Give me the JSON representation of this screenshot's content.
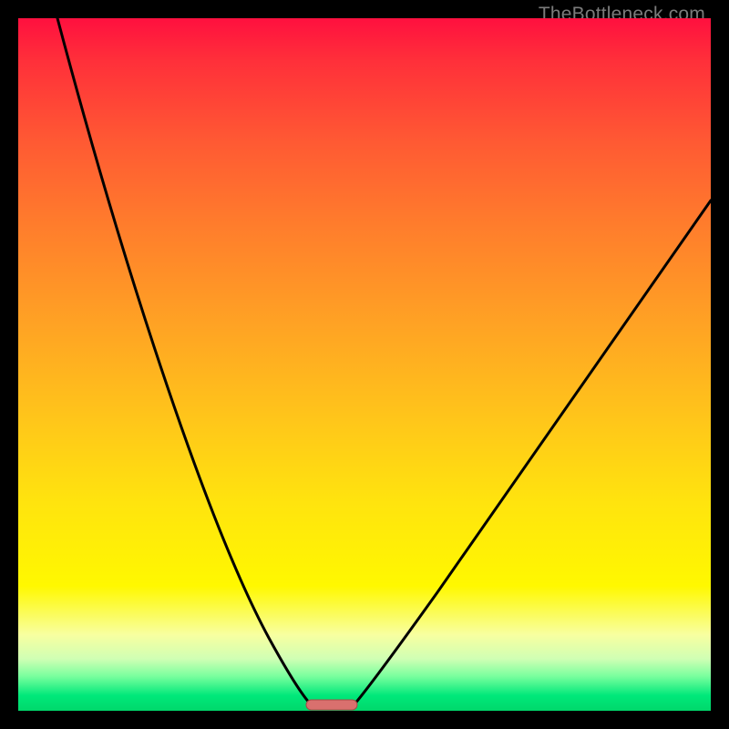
{
  "watermark": "TheBottleneck.com",
  "colors": {
    "gradient_top": "#ff103f",
    "gradient_mid": "#ffe40e",
    "gradient_bottom": "#00d86b",
    "curve": "#000000",
    "marker_fill": "#d9706e",
    "marker_stroke": "#a74a47",
    "frame": "#000000"
  },
  "chart_data": {
    "type": "line",
    "title": "",
    "subtitle": "",
    "xlabel": "",
    "ylabel": "",
    "xlim": [
      0,
      100
    ],
    "ylim": [
      0,
      100
    ],
    "grid": false,
    "legend": false,
    "annotations": [
      {
        "text": "TheBottleneck.com",
        "role": "watermark",
        "position": "top-right"
      }
    ],
    "series": [
      {
        "name": "left-curve",
        "x": [
          5.7,
          10,
          15,
          20,
          25,
          30,
          35,
          40,
          42.4
        ],
        "values": [
          100,
          82,
          64,
          49,
          36,
          25,
          15,
          6,
          0.8
        ]
      },
      {
        "name": "right-curve",
        "x": [
          48.4,
          55,
          65,
          75,
          85,
          95,
          100
        ],
        "values": [
          0.8,
          6,
          20,
          38,
          56,
          70,
          73.7
        ]
      }
    ],
    "marker": {
      "shape": "rounded-bar",
      "x_center": 45.3,
      "width": 7.4,
      "y": 0.8,
      "color": "#d9706e"
    },
    "background_gradient": {
      "direction": "vertical",
      "stops": [
        {
          "pos": 0.0,
          "color": "#ff103f"
        },
        {
          "pos": 0.3,
          "color": "#ff7d2c"
        },
        {
          "pos": 0.58,
          "color": "#ffc61a"
        },
        {
          "pos": 0.82,
          "color": "#fff800"
        },
        {
          "pos": 0.95,
          "color": "#7aff9e"
        },
        {
          "pos": 1.0,
          "color": "#00d86b"
        }
      ]
    }
  }
}
